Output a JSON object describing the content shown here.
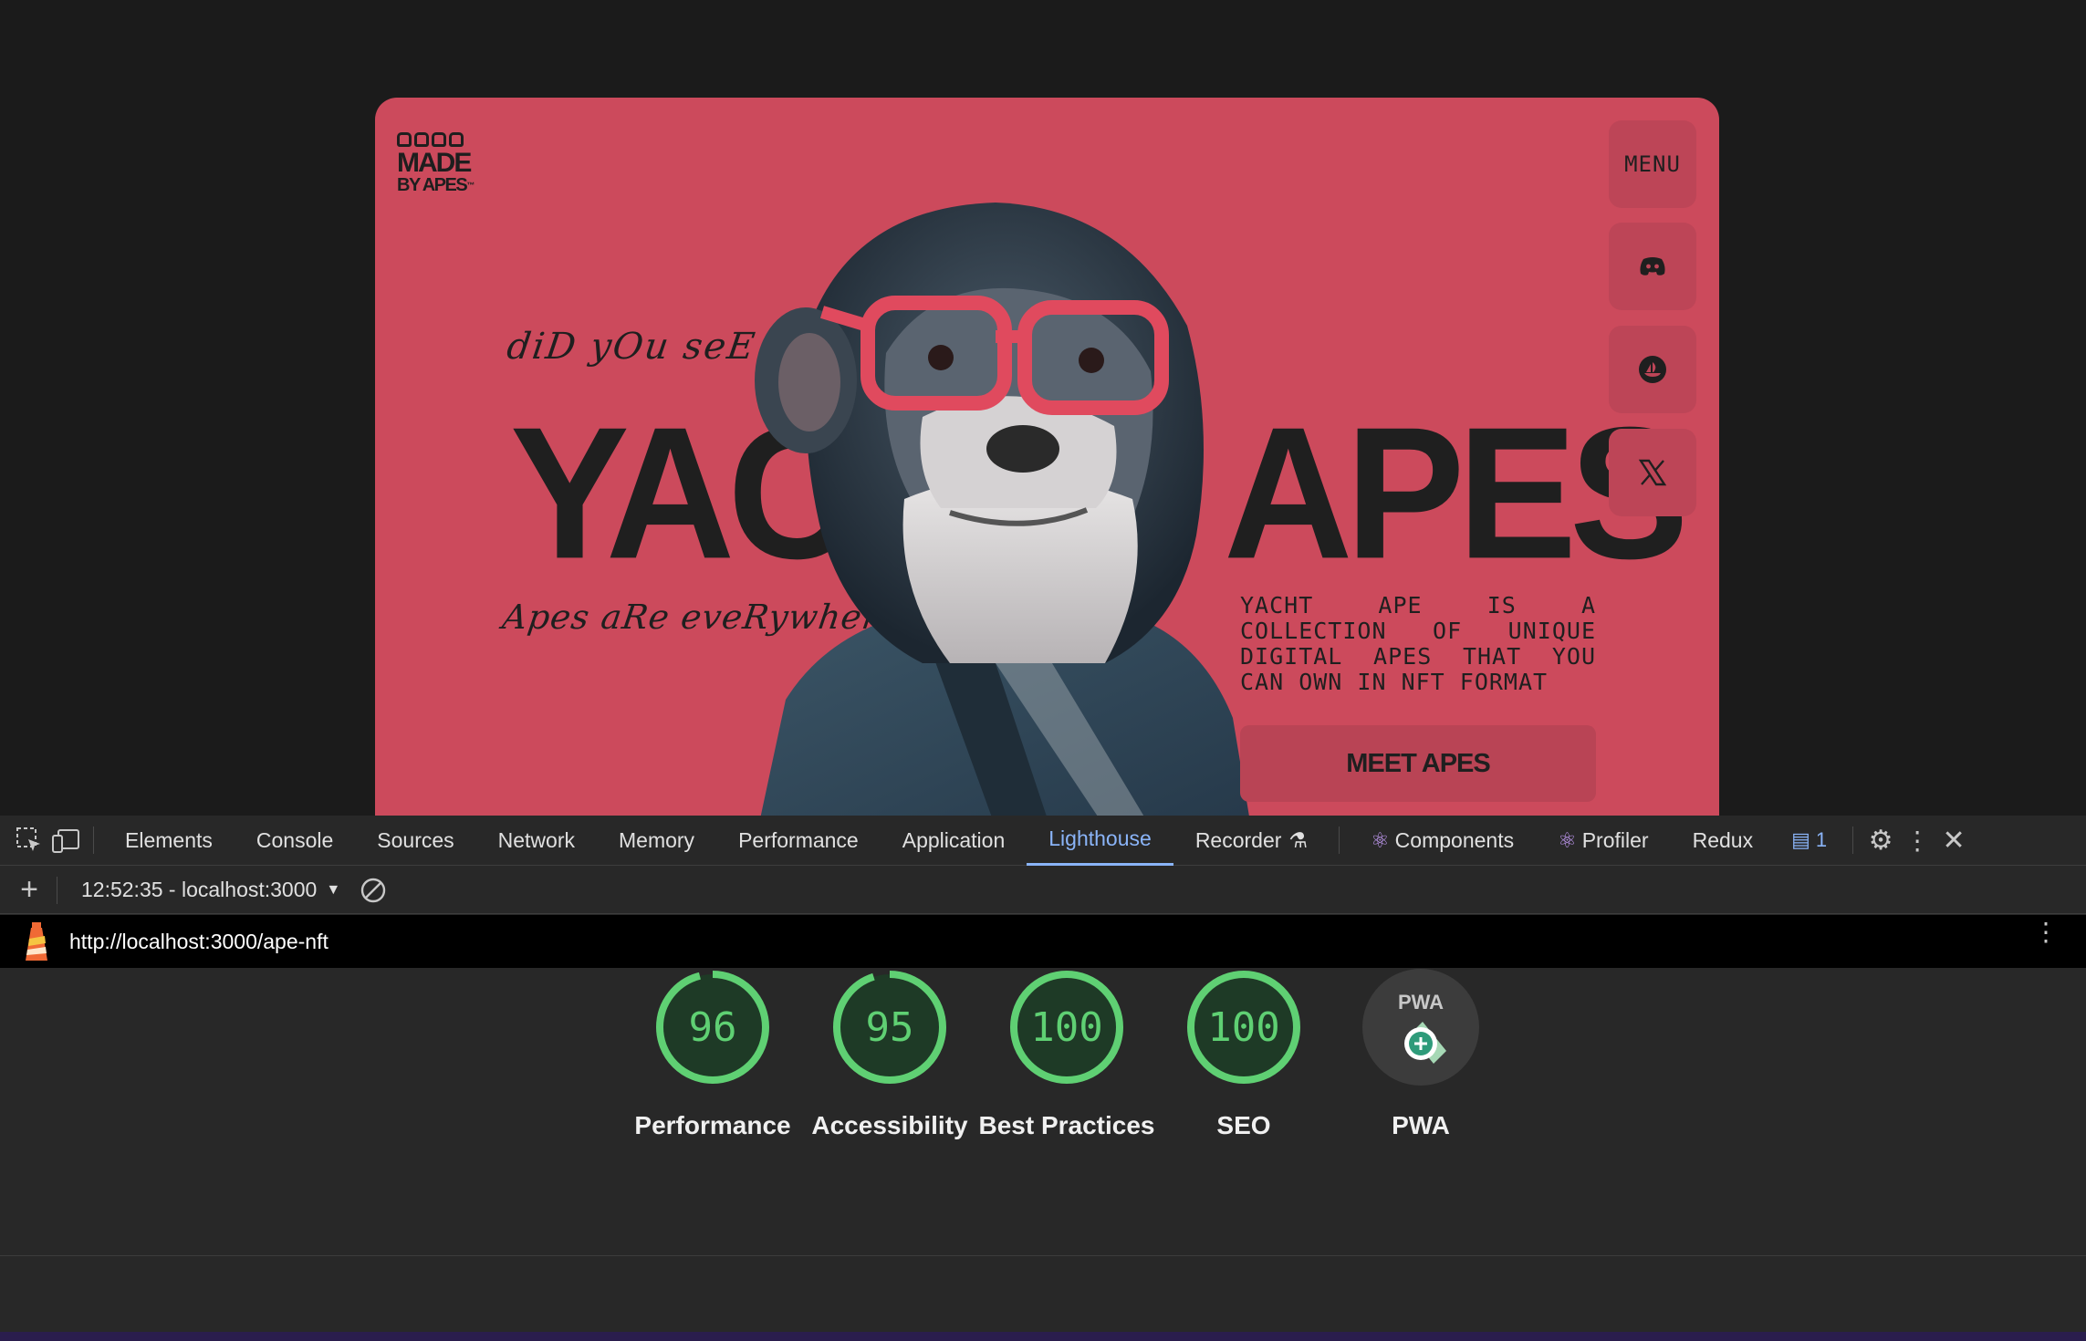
{
  "hero": {
    "logo_line1": "MADE",
    "logo_line2": "BY APES",
    "logo_tm": "™",
    "tagline_top": "diD yOu seE iT ?",
    "tagline_bottom": "Apes aRe eveRywhere",
    "title_left": "YACHT",
    "title_right": "APES",
    "description": "Yacht ape is a collection of unique digital apes that you can own in NFT format",
    "cta_label": "MEET APES",
    "menu_label": "MENU",
    "accent": "#cc4a5c"
  },
  "devtools": {
    "tabs": [
      "Elements",
      "Console",
      "Sources",
      "Network",
      "Memory",
      "Performance",
      "Application",
      "Lighthouse",
      "Recorder",
      "Components",
      "Profiler",
      "Redux"
    ],
    "active_tab": "Lighthouse",
    "issues_count": "1",
    "report_select": "12:52:35 - localhost:3000",
    "report_url": "http://localhost:3000/ape-nft"
  },
  "scores": [
    {
      "label": "Performance",
      "value": "96",
      "percent": 96
    },
    {
      "label": "Accessibility",
      "value": "95",
      "percent": 95
    },
    {
      "label": "Best Practices",
      "value": "100",
      "percent": 100
    },
    {
      "label": "SEO",
      "value": "100",
      "percent": 100
    }
  ],
  "pwa": {
    "label": "PWA",
    "badge_text": "PWA"
  },
  "colors": {
    "score_good": "#5fd073",
    "devtools_bg": "#282828",
    "active_tab": "#8ab4f8"
  }
}
